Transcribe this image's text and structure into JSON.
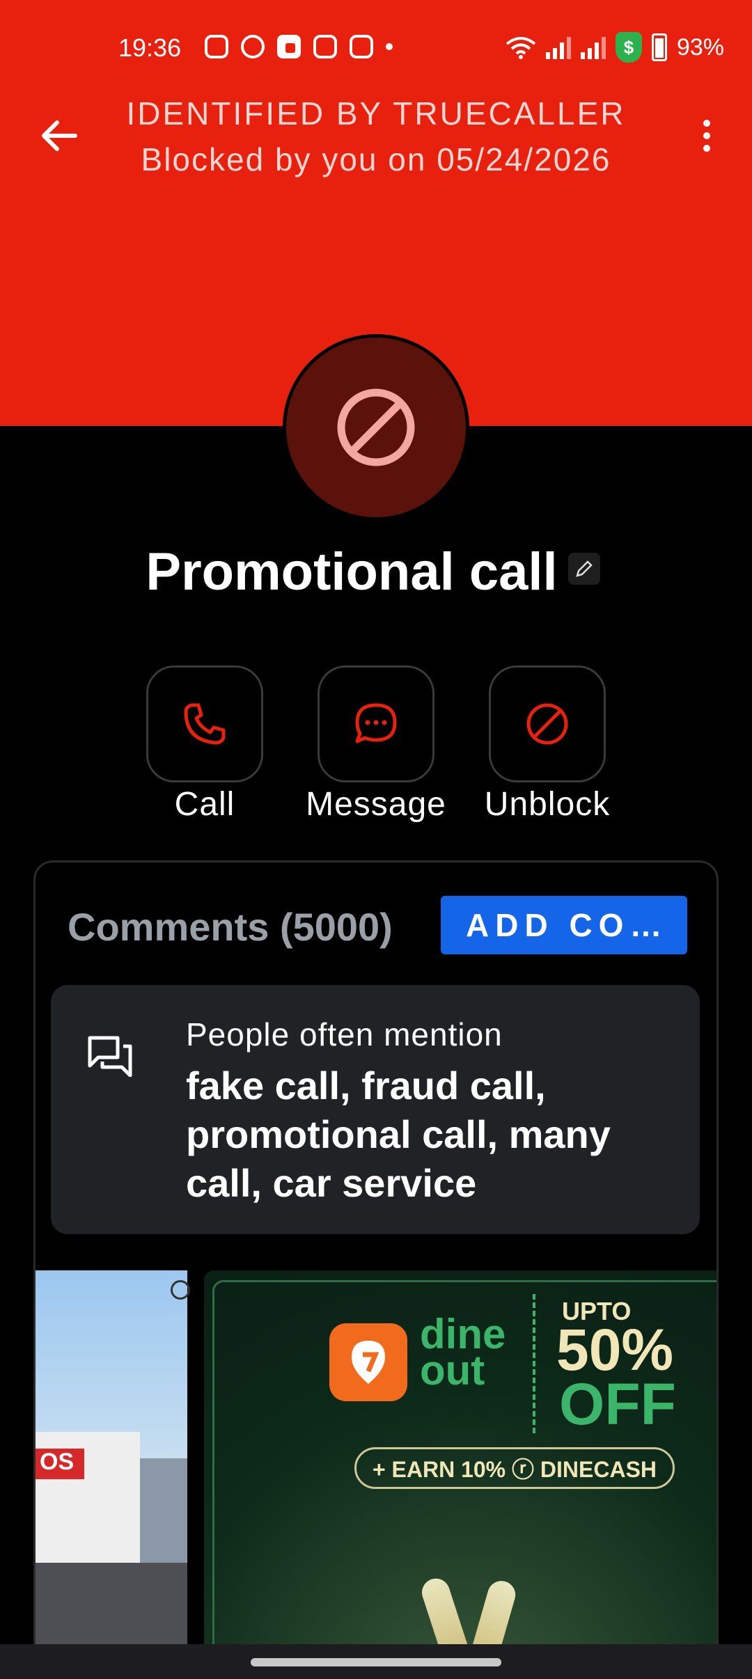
{
  "status_bar": {
    "time": "19:36",
    "battery": "93%"
  },
  "header": {
    "line1": "IDENTIFIED BY TRUECALLER",
    "line2": "Blocked by you on 05/24/2026",
    "bg_color": "#E8210F"
  },
  "contact": {
    "name": "Promotional call"
  },
  "actions": [
    {
      "label": "Call",
      "icon": "phone-icon"
    },
    {
      "label": "Message",
      "icon": "chat-bubble-icon"
    },
    {
      "label": "Unblock",
      "icon": "block-icon"
    }
  ],
  "comments": {
    "title": "Comments (5000)",
    "add_label": "ADD CO…",
    "mention_heading": "People often mention",
    "mention_text": "fake call, fraud call, promotional call, many call, car service"
  },
  "ads": {
    "left_sign": "OS",
    "main": {
      "brand_line1": "dine",
      "brand_line2": "out",
      "upto": "UPTO",
      "percent": "50%",
      "off": "OFF",
      "earn": "+ EARN 10% ⓡ DINECASH"
    }
  },
  "colors": {
    "accent_red": "#E8210F",
    "button_blue": "#1565E8",
    "brand_green": "#3AB56A"
  }
}
